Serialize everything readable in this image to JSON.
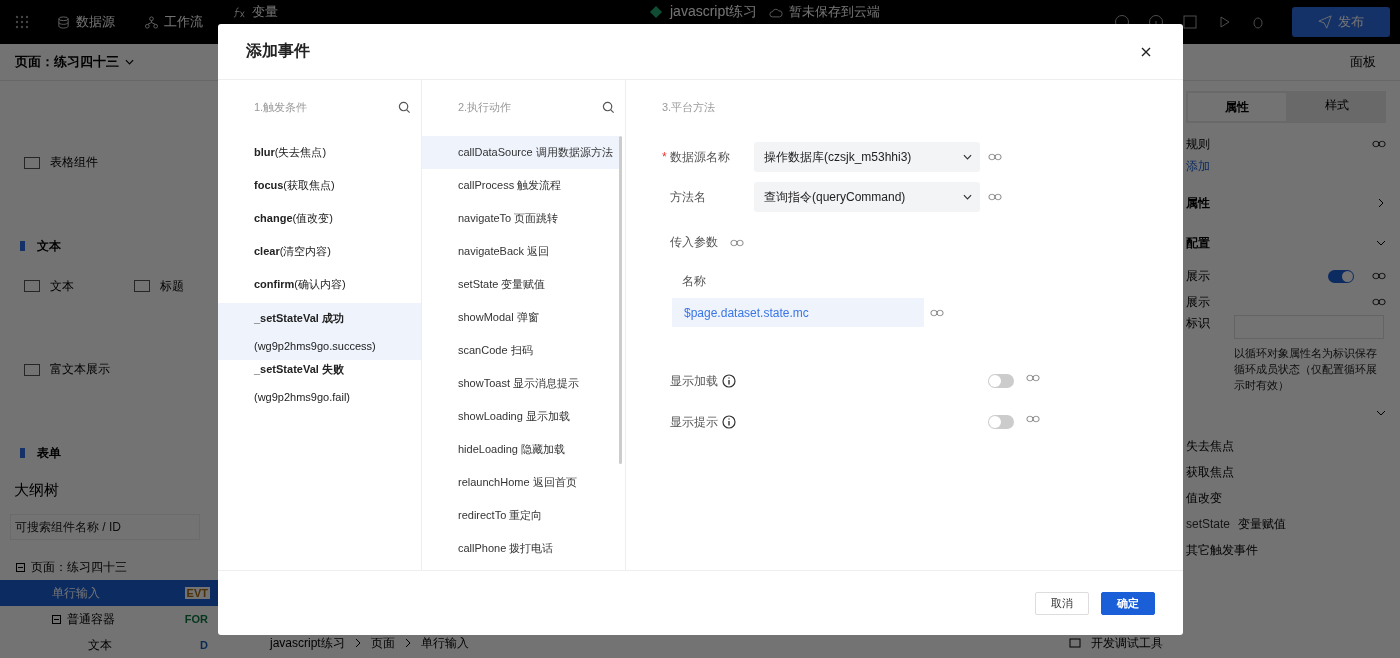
{
  "topbar": {
    "nav": [
      {
        "label": "数据源"
      },
      {
        "label": "工作流"
      },
      {
        "label": "变量"
      }
    ],
    "project": "javascript练习",
    "save_status": "暂未保存到云端",
    "publish": "发布"
  },
  "subheader": {
    "page": "页面：练习四十三",
    "panel": "面板"
  },
  "components": [
    {
      "kind": "item",
      "label": "表格组件"
    },
    {
      "kind": "group",
      "label": "文本"
    },
    {
      "kind": "pair",
      "items": [
        {
          "label": "文本"
        },
        {
          "label": "标题"
        }
      ]
    },
    {
      "kind": "item",
      "label": "富文本展示"
    },
    {
      "kind": "group",
      "label": "表单"
    }
  ],
  "outline": {
    "title": "大纲树",
    "search_placeholder": "可搜索组件名称 / ID",
    "tree": [
      {
        "label": "页面：练习四十三",
        "expanded": true,
        "selected": false,
        "children": [
          {
            "label": "单行输入",
            "selected": true,
            "badge": "EVT"
          },
          {
            "label": "普通容器",
            "expanded": true,
            "selected": false,
            "badge": "FOR",
            "children": [
              {
                "label": "文本",
                "selected": false,
                "badge": "D"
              }
            ]
          }
        ]
      }
    ]
  },
  "breadcrumb": [
    "javascript练习",
    "页面",
    "单行输入"
  ],
  "debug_tool": "开发调试工具",
  "right_panel": {
    "tabs": [
      {
        "label": "属性",
        "selected": true
      },
      {
        "label": "样式",
        "selected": false
      }
    ],
    "rows": [
      {
        "kind": "label",
        "label": "规则",
        "link": true
      },
      {
        "kind": "action",
        "label": "添加"
      },
      {
        "kind": "section",
        "label": "属性",
        "expanded": false
      },
      {
        "kind": "section",
        "label": "配置",
        "expanded": true
      },
      {
        "kind": "toggle",
        "label": "展示",
        "on": true
      },
      {
        "kind": "label",
        "label": "展示",
        "link": true
      },
      {
        "kind": "field",
        "label": "标识",
        "hint": "以循环对象属性名为标识保存循环成员状态（仅配置循环展示时有效）"
      },
      {
        "kind": "section",
        "expanded": true
      },
      {
        "kind": "event",
        "label": "失去焦点"
      },
      {
        "kind": "event",
        "label": "获取焦点"
      },
      {
        "kind": "event",
        "label": "值改变"
      },
      {
        "kind": "event",
        "prefix": "setState",
        "label": "变量赋值"
      },
      {
        "kind": "event",
        "label": "其它触发事件"
      }
    ]
  },
  "dialog": {
    "title": "添加事件",
    "triggers": {
      "title": "1.触发条件",
      "items": [
        {
          "label": "**blur**(失去焦点)",
          "selected": false
        },
        {
          "label": "**focus**(获取焦点)",
          "selected": false
        },
        {
          "label": "**change**(值改变)",
          "selected": false
        },
        {
          "label": "**clear**(清空内容)",
          "selected": false
        },
        {
          "label": "**confirm**(确认内容)",
          "selected": false
        },
        {
          "label": "**_setStateVal 成功**",
          "sub": "(wg9p2hms9go.success)",
          "selected": true
        },
        {
          "label": "**_setStateVal 失败**",
          "sub": "(wg9p2hms9go.fail)",
          "selected": false
        }
      ]
    },
    "actions": {
      "title": "2.执行动作",
      "items": [
        {
          "label": "callDataSource 调用数据源方法",
          "selected": true
        },
        {
          "label": "callProcess 触发流程",
          "selected": false
        },
        {
          "label": "navigateTo 页面跳转",
          "selected": false
        },
        {
          "label": "navigateBack 返回",
          "selected": false
        },
        {
          "label": "setState 变量赋值",
          "selected": false
        },
        {
          "label": "showModal 弹窗",
          "selected": false
        },
        {
          "label": "scanCode 扫码",
          "selected": false
        },
        {
          "label": "showToast 显示消息提示",
          "selected": false
        },
        {
          "label": "showLoading 显示加载",
          "selected": false
        },
        {
          "label": "hideLoading 隐藏加载",
          "selected": false
        },
        {
          "label": "relaunchHome 返回首页",
          "selected": false
        },
        {
          "label": "redirectTo 重定向",
          "selected": false
        },
        {
          "label": "callPhone 拨打电话",
          "selected": false
        }
      ]
    },
    "method": {
      "title": "3.平台方法",
      "fields": [
        {
          "kind": "select",
          "label": "数据源名称",
          "required_mark": "*",
          "value": "操作数据库(czsjk_m53hhi3)"
        },
        {
          "kind": "select",
          "label": "方法名",
          "value": "查询指令(queryCommand)"
        },
        {
          "kind": "params",
          "label": "传入参数",
          "column": "名称",
          "value": "$page.dataset.state.mc"
        },
        {
          "kind": "toggle",
          "label": "显示加载",
          "on": false
        },
        {
          "kind": "toggle",
          "label": "显示提示",
          "on": false
        }
      ]
    },
    "buttons": [
      {
        "label": "取消",
        "primary": false
      },
      {
        "label": "确定",
        "primary": true
      }
    ]
  }
}
